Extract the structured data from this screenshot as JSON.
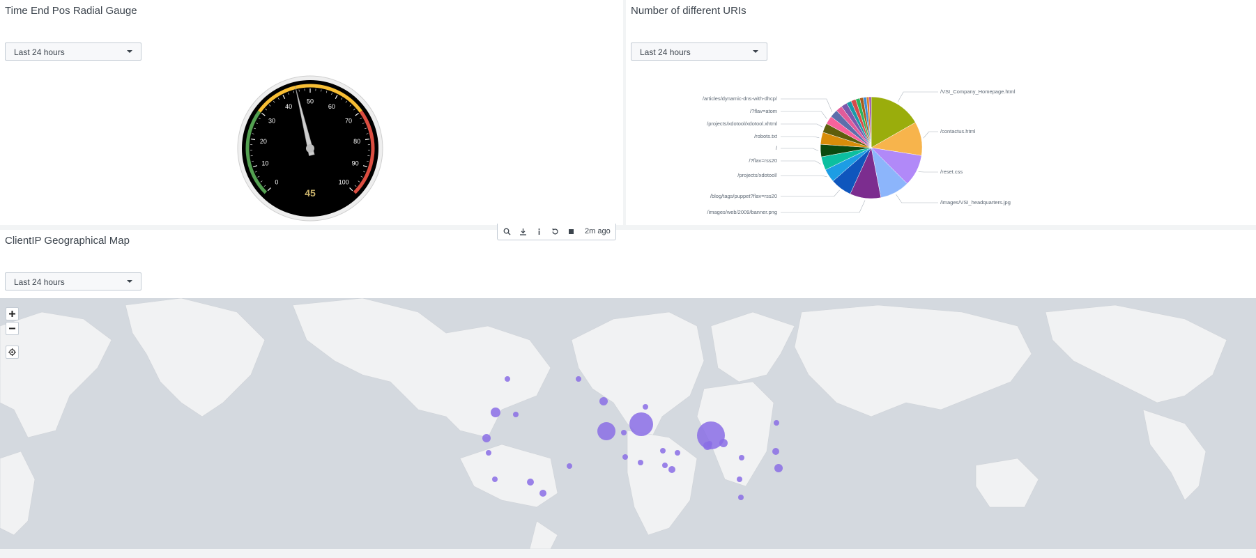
{
  "gauge_panel": {
    "title": "Time End Pos Radial Gauge",
    "time_range": "Last 24 hours",
    "value": "45",
    "ticks": [
      "0",
      "10",
      "20",
      "30",
      "40",
      "50",
      "60",
      "70",
      "80",
      "90",
      "100"
    ],
    "colors": {
      "green": "#53a051",
      "yellow": "#f8be34",
      "red": "#dc4e41",
      "face": "#000000",
      "value_text": "#c9b26a"
    }
  },
  "uri_panel": {
    "title": "Number of different URIs",
    "time_range": "Last 24 hours",
    "labels": [
      "/VSI_Company_Homepage.html",
      "/contactus.html",
      "/reset.css",
      "/images/VSI_headquarters.jpg",
      "/images/web/2009/banner.png",
      "/blog/tags/puppet?flav=rss20",
      "/projects/xdotool/",
      "/?flav=rss20",
      "/",
      "/robots.txt",
      "/projects/xdotool/xdotool.xhtml",
      "/?flav=atom",
      "/articles/dynamic-dns-with-dhcp/"
    ]
  },
  "chart_data": {
    "type": "pie",
    "categories": [
      "/VSI_Company_Homepage.html",
      "/contactus.html",
      "/reset.css",
      "/images/VSI_headquarters.jpg",
      "/images/web/2009/banner.png",
      "/blog/tags/puppet?flav=rss20",
      "/projects/xdotool/",
      "/?flav=rss20",
      "/",
      "/robots.txt",
      "/projects/xdotool/xdotool.xhtml",
      "/?flav=atom",
      "/articles/dynamic-dns-with-dhcp/",
      "",
      "",
      "",
      "",
      "",
      "",
      "",
      "",
      ""
    ],
    "values": [
      16.5,
      10.6,
      9.9,
      9.3,
      9.7,
      6.7,
      4.2,
      4.2,
      3.9,
      3.8,
      2.9,
      2.6,
      2.5,
      2.0,
      1.9,
      1.5,
      1.5,
      1.3,
      1.1,
      1.0,
      0.8,
      0.7
    ],
    "colors": [
      "#9aad0c",
      "#f7b44c",
      "#b189f8",
      "#8cb5fb",
      "#7c2d8f",
      "#0f56bd",
      "#1d9de4",
      "#0cbfa0",
      "#0b4a0f",
      "#d88d0a",
      "#5e5e0c",
      "#f8629c",
      "#5c6eab",
      "#e25b9a",
      "#7b58ad",
      "#1a9aa8",
      "#d64b4b",
      "#2cb35f",
      "#a85b1d",
      "#3c8ed6",
      "#e07f2c",
      "#9c4fb5"
    ]
  },
  "map_panel": {
    "title": "ClientIP Geographical Map",
    "time_range": "Last 24 hours",
    "marker_color": "#8a6de5"
  },
  "toolbar": {
    "icons": [
      "search-icon",
      "download-icon",
      "info-icon",
      "refresh-icon",
      "stop-icon"
    ],
    "last_refresh": "2m ago"
  }
}
